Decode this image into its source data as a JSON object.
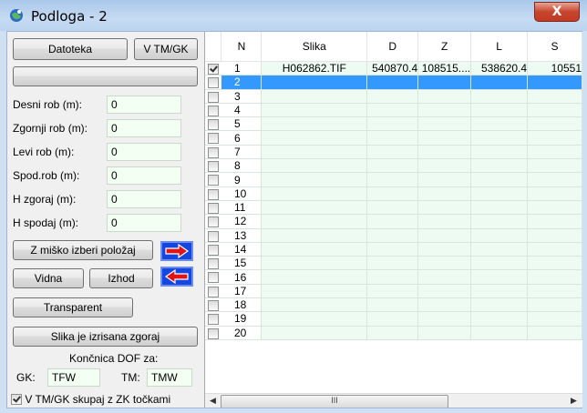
{
  "window": {
    "title": "Podloga - 2",
    "close_label": "X"
  },
  "toolbar": {
    "file_button": "Datoteka",
    "coord_button": "V TM/GK",
    "blank_button": ""
  },
  "fields": [
    {
      "label": "Desni rob (m):",
      "value": "0"
    },
    {
      "label": "Zgornji rob (m):",
      "value": "0"
    },
    {
      "label": "Levi rob (m):",
      "value": "0"
    },
    {
      "label": "Spod.rob (m):",
      "value": "0"
    },
    {
      "label": "H zgoraj (m):",
      "value": "0"
    },
    {
      "label": "H spodaj (m):",
      "value": "0"
    }
  ],
  "actions": {
    "mouse_select": "Z miško izberi položaj",
    "visible": "Vidna",
    "exit": "Izhod",
    "transparent": "Transparent",
    "drawn_on_top": "Slika je izrisana zgoraj"
  },
  "dof": {
    "heading": "Končnica DOF za:",
    "gk_label": "GK:",
    "gk_value": "TFW",
    "tm_label": "TM:",
    "tm_value": "TMW"
  },
  "together_checkbox": {
    "label": "V TM/GK skupaj z ZK točkami",
    "checked": true
  },
  "grid": {
    "columns": [
      "",
      "N",
      "Slika",
      "D",
      "Z",
      "L",
      "S"
    ],
    "rows": [
      {
        "checked": true,
        "n": "1",
        "slika": "H062862.TIF",
        "d": "540870.4",
        "z": "108515....",
        "l": "538620.4",
        "s": "10551"
      },
      {
        "checked": false,
        "n": "2",
        "selected": true
      },
      {
        "checked": false,
        "n": "3"
      },
      {
        "checked": false,
        "n": "4"
      },
      {
        "checked": false,
        "n": "5"
      },
      {
        "checked": false,
        "n": "6"
      },
      {
        "checked": false,
        "n": "7"
      },
      {
        "checked": false,
        "n": "8"
      },
      {
        "checked": false,
        "n": "9"
      },
      {
        "checked": false,
        "n": "10"
      },
      {
        "checked": false,
        "n": "11"
      },
      {
        "checked": false,
        "n": "12"
      },
      {
        "checked": false,
        "n": "13"
      },
      {
        "checked": false,
        "n": "14"
      },
      {
        "checked": false,
        "n": "15"
      },
      {
        "checked": false,
        "n": "16"
      },
      {
        "checked": false,
        "n": "17"
      },
      {
        "checked": false,
        "n": "18"
      },
      {
        "checked": false,
        "n": "19"
      },
      {
        "checked": false,
        "n": "20"
      }
    ],
    "scroll_thumb_label": "III"
  },
  "colors": {
    "selection": "#3399ff",
    "cell_bg": "#eefbf3",
    "arrow_box": "#1446e0",
    "arrow_red": "#e01414",
    "close": "#c7462e"
  }
}
